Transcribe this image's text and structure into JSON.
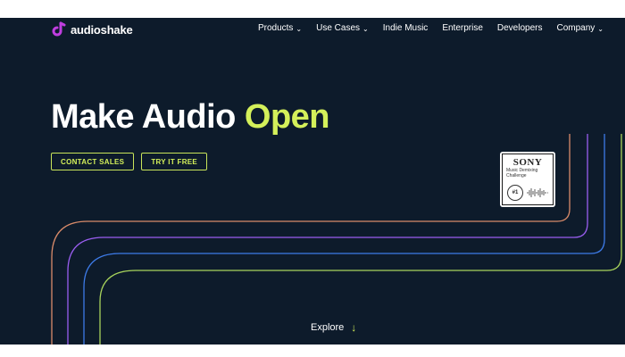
{
  "brand": {
    "logo_text": "audioshake",
    "accent_color": "#d4f05a",
    "logo_color": "#c03ee0",
    "background": "#0d1b2b"
  },
  "nav": {
    "items": [
      {
        "label": "Products",
        "icon": "chevron-down-icon"
      },
      {
        "label": "Use Cases",
        "icon": "chevron-down-icon"
      },
      {
        "label": "Indie Music",
        "icon": null
      },
      {
        "label": "Enterprise",
        "icon": null
      },
      {
        "label": "Developers",
        "icon": null
      },
      {
        "label": "Company",
        "icon": "chevron-down-icon"
      }
    ]
  },
  "hero": {
    "headline_main": "Make Audio ",
    "headline_accent": "Open",
    "cta_primary": "CONTACT SALES",
    "cta_secondary": "TRY IT FREE"
  },
  "badge": {
    "brand": "SONY",
    "line1": "Music Demixing",
    "line2": "Challenge",
    "rank": "#1"
  },
  "explore": {
    "label": "Explore",
    "icon": "arrow-down-icon"
  }
}
